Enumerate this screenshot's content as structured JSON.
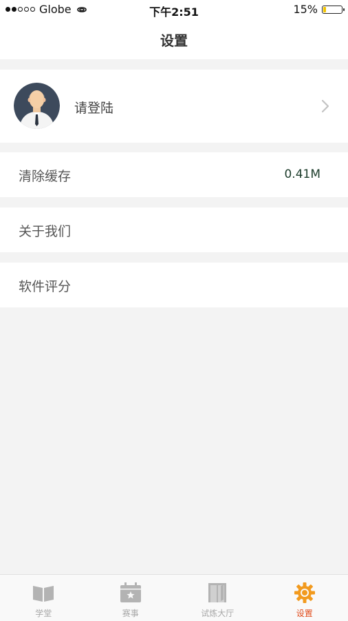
{
  "status_bar": {
    "carrier": "Globe",
    "time": "下午2:51",
    "battery_percent": "15%",
    "battery_level": 0.15,
    "signal_bars": 2
  },
  "nav": {
    "title": "设置"
  },
  "profile": {
    "login_label": "请登陆"
  },
  "settings": {
    "clear_cache_label": "清除缓存",
    "cache_size": "0.41M",
    "about_label": "关于我们",
    "rate_label": "软件评分"
  },
  "tab_bar": {
    "active_color": "#f29a1e",
    "active_label_color": "#e14b1a",
    "inactive_color": "#b3b3b3",
    "tabs": [
      {
        "label": "学堂",
        "icon": "book-icon"
      },
      {
        "label": "赛事",
        "icon": "calendar-icon"
      },
      {
        "label": "试炼大厅",
        "icon": "door-icon"
      },
      {
        "label": "设置",
        "icon": "gear-icon"
      }
    ]
  }
}
